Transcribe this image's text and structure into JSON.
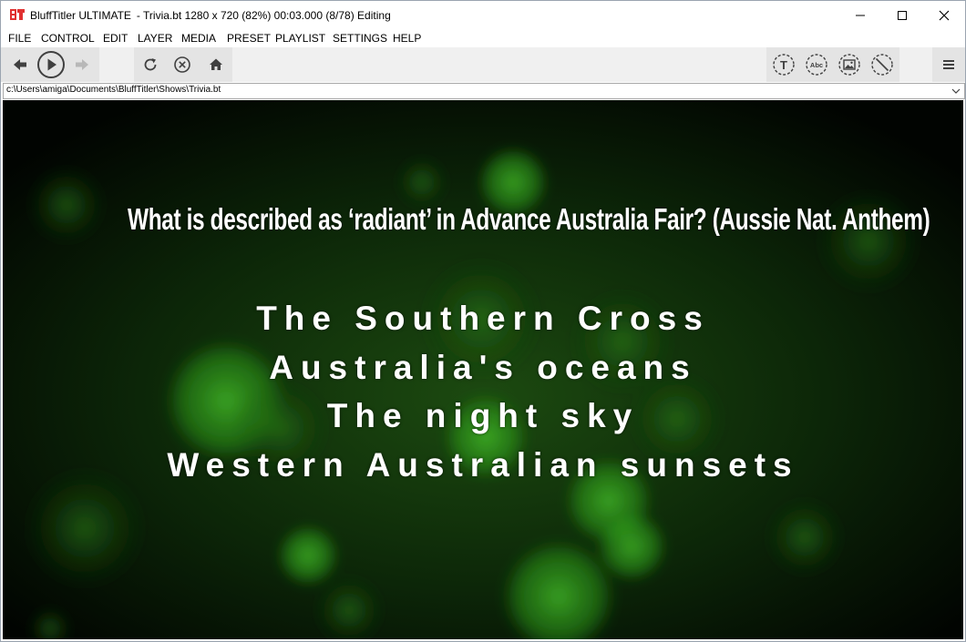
{
  "window": {
    "app_name": "BluffTitler ULTIMATE",
    "doc_info": "- Trivia.bt 1280 x 720 (82%) 00:03.000 (8/78) Editing",
    "logo_color": "#e03030"
  },
  "menu": [
    "FILE",
    "CONTROL",
    "EDIT",
    "LAYER",
    "MEDIA",
    "PRESET",
    "PLAYLIST",
    "SETTINGS",
    "HELP"
  ],
  "toolbar": {
    "icons": [
      "back-arrow-icon",
      "play-icon",
      "forward-arrow-icon",
      "refresh-icon",
      "stop-icon",
      "home-icon",
      "text-layer-icon",
      "abc-layer-icon",
      "picture-layer-icon",
      "no-layer-icon",
      "hamburger-menu-icon"
    ],
    "text_icon_label": "T",
    "abc_icon_label": "Abc"
  },
  "path": {
    "value": "c:\\Users\\amiga\\Documents\\BluffTitler\\Shows\\Trivia.bt"
  },
  "canvas": {
    "question": "What is described as ‘radiant’ in Advance Australia Fair? (Aussie Nat. Anthem)",
    "answers": [
      "The Southern Cross",
      "Australia's oceans",
      "The night sky",
      "Western Australian sunsets"
    ],
    "background_color": "#020802",
    "bokeh_color": "#2fa81a"
  }
}
